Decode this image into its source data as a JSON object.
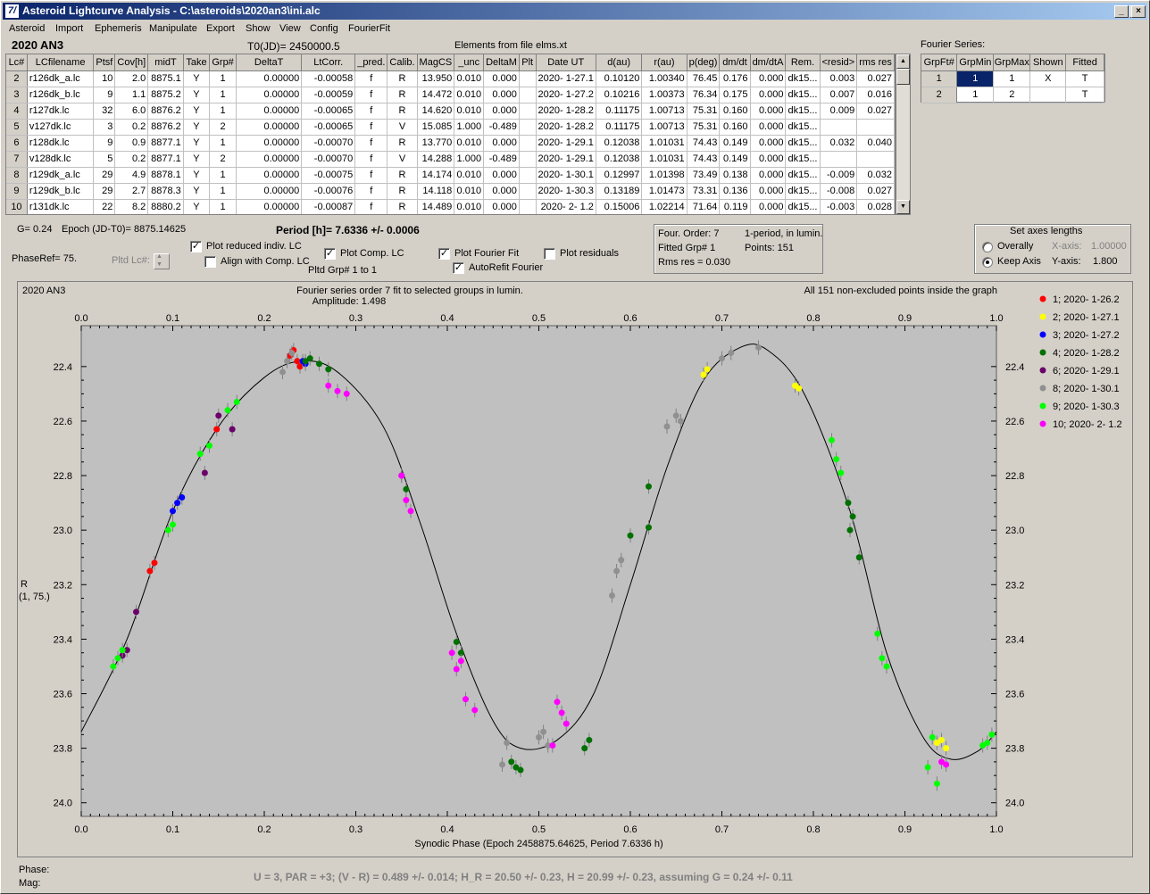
{
  "window": {
    "title": "Asteroid Lightcurve Analysis - C:\\asteroids\\2020an3\\ini.alc",
    "icon": "program-icon"
  },
  "menu": [
    "Asteroid",
    "Import",
    "Ephemeris",
    "Manipulate",
    "Export",
    "Show",
    "View",
    "Config",
    "FourierFit"
  ],
  "header": {
    "asteroid": "2020 AN3",
    "t0": "T0(JD)= 2450000.5",
    "elements": "Elements from file elms.xt"
  },
  "grid": {
    "columns": [
      "Lc#",
      "LCfilename",
      "Ptsf",
      "Cov[h]",
      "midT",
      "Take",
      "Grp#",
      "DeltaT",
      "LtCorr.",
      "_pred.",
      "Calib.",
      "MagCS",
      "_unc",
      "DeltaM",
      "Plt",
      "Date UT",
      "d(au)",
      "r(au)",
      "p(deg)",
      "dm/dt",
      "dm/dtA",
      "Rem.",
      "<resid>",
      "rms res"
    ],
    "rows": [
      [
        "2",
        "r126dk_a.lc",
        "10",
        "2.0",
        "8875.1",
        "Y",
        "1",
        "0.00000",
        "-0.00058",
        "f",
        "R",
        "13.950",
        "0.010",
        "0.000",
        "",
        "2020- 1-27.1",
        "0.10120",
        "1.00340",
        "76.45",
        "0.176",
        "0.000",
        "dk15...",
        "0.003",
        "0.027"
      ],
      [
        "3",
        "r126dk_b.lc",
        "9",
        "1.1",
        "8875.2",
        "Y",
        "1",
        "0.00000",
        "-0.00059",
        "f",
        "R",
        "14.472",
        "0.010",
        "0.000",
        "",
        "2020- 1-27.2",
        "0.10216",
        "1.00373",
        "76.34",
        "0.175",
        "0.000",
        "dk15...",
        "0.007",
        "0.016"
      ],
      [
        "4",
        "r127dk.lc",
        "32",
        "6.0",
        "8876.2",
        "Y",
        "1",
        "0.00000",
        "-0.00065",
        "f",
        "R",
        "14.620",
        "0.010",
        "0.000",
        "",
        "2020- 1-28.2",
        "0.11175",
        "1.00713",
        "75.31",
        "0.160",
        "0.000",
        "dk15...",
        "0.009",
        "0.027"
      ],
      [
        "5",
        "v127dk.lc",
        "3",
        "0.2",
        "8876.2",
        "Y",
        "2",
        "0.00000",
        "-0.00065",
        "f",
        "V",
        "15.085",
        "1.000",
        "-0.489",
        "",
        "2020- 1-28.2",
        "0.11175",
        "1.00713",
        "75.31",
        "0.160",
        "0.000",
        "dk15...",
        "",
        ""
      ],
      [
        "6",
        "r128dk.lc",
        "9",
        "0.9",
        "8877.1",
        "Y",
        "1",
        "0.00000",
        "-0.00070",
        "f",
        "R",
        "13.770",
        "0.010",
        "0.000",
        "",
        "2020- 1-29.1",
        "0.12038",
        "1.01031",
        "74.43",
        "0.149",
        "0.000",
        "dk15...",
        "0.032",
        "0.040"
      ],
      [
        "7",
        "v128dk.lc",
        "5",
        "0.2",
        "8877.1",
        "Y",
        "2",
        "0.00000",
        "-0.00070",
        "f",
        "V",
        "14.288",
        "1.000",
        "-0.489",
        "",
        "2020- 1-29.1",
        "0.12038",
        "1.01031",
        "74.43",
        "0.149",
        "0.000",
        "dk15...",
        "",
        ""
      ],
      [
        "8",
        "r129dk_a.lc",
        "29",
        "4.9",
        "8878.1",
        "Y",
        "1",
        "0.00000",
        "-0.00075",
        "f",
        "R",
        "14.174",
        "0.010",
        "0.000",
        "",
        "2020- 1-30.1",
        "0.12997",
        "1.01398",
        "73.49",
        "0.138",
        "0.000",
        "dk15...",
        "-0.009",
        "0.032"
      ],
      [
        "9",
        "r129dk_b.lc",
        "29",
        "2.7",
        "8878.3",
        "Y",
        "1",
        "0.00000",
        "-0.00076",
        "f",
        "R",
        "14.118",
        "0.010",
        "0.000",
        "",
        "2020- 1-30.3",
        "0.13189",
        "1.01473",
        "73.31",
        "0.136",
        "0.000",
        "dk15...",
        "-0.008",
        "0.027"
      ],
      [
        "10",
        "r131dk.lc",
        "22",
        "8.2",
        "8880.2",
        "Y",
        "1",
        "0.00000",
        "-0.00087",
        "f",
        "R",
        "14.489",
        "0.010",
        "0.000",
        "",
        "2020- 2- 1.2",
        "0.15006",
        "1.02214",
        "71.64",
        "0.119",
        "0.000",
        "dk15...",
        "-0.003",
        "0.028"
      ]
    ]
  },
  "fourier_grid": {
    "title": "Fourier Series:",
    "columns": [
      "GrpFt#",
      "GrpMin",
      "GrpMax",
      "Shown",
      "Fitted"
    ],
    "rows": [
      [
        "1",
        "1",
        "1",
        "X",
        "T"
      ],
      [
        "2",
        "1",
        "2",
        "",
        "T"
      ]
    ]
  },
  "controls": {
    "g": "G= 0.24",
    "epoch": "Epoch (JD-T0)= 8875.14625",
    "period": "Period [h]= 7.6336 +/- 0.0006",
    "phaseref": "PhaseRef= 75.",
    "pltd_lc": "Pltd Lc#:",
    "plot_reduced": "Plot reduced indiv. LC",
    "align": "Align with Comp. LC",
    "plot_comp": "Plot Comp. LC",
    "pltd_grp": "Pltd Grp#  1   to   1",
    "plot_fourier": "Plot Fourier Fit",
    "autorefit": "AutoRefit Fourier",
    "plot_residuals": "Plot residuals",
    "checks": {
      "plot_reduced": true,
      "align": false,
      "plot_comp": true,
      "plot_fourier": true,
      "autorefit": true,
      "plot_residuals": false
    }
  },
  "fitinfo": {
    "order": "Four. Order:  7",
    "period_lumin": "1-period, in lumin.",
    "fitted": "Fitted Grp# 1",
    "points": "Points: 151",
    "rms": "Rms res     = 0.030"
  },
  "axes_box": {
    "title": "Set axes lengths",
    "overally": "Overally",
    "keep": "Keep Axis",
    "xaxis_label": "X-axis:",
    "xaxis_val": "1.00000",
    "yaxis_label": "Y-axis:",
    "yaxis_val": "1.800",
    "selected": "keep"
  },
  "chart_data": {
    "type": "scatter",
    "title_left": "2020 AN3",
    "title": "Fourier series order 7 fit to selected groups in lumin.",
    "subtitle": "Amplitude: 1.498",
    "title_right": "All 151 non-excluded points inside the graph",
    "xlabel": "Synodic Phase (Epoch 2458875.64625, Period 7.6336 h)",
    "ylabel": "R",
    "ylabel2": "(1, 75.)",
    "xlim": [
      0.0,
      1.0
    ],
    "ylim": [
      24.05,
      22.25
    ],
    "xticks": [
      "0.0",
      "0.1",
      "0.2",
      "0.3",
      "0.4",
      "0.5",
      "0.6",
      "0.7",
      "0.8",
      "0.9",
      "1.0"
    ],
    "yticks": [
      "22.4",
      "22.6",
      "22.8",
      "23.0",
      "23.2",
      "23.4",
      "23.6",
      "23.8",
      "24.0"
    ],
    "grid": false,
    "legend_position": "right",
    "curve": [
      [
        0.0,
        23.74
      ],
      [
        0.05,
        23.4
      ],
      [
        0.1,
        22.93
      ],
      [
        0.15,
        22.62
      ],
      [
        0.2,
        22.44
      ],
      [
        0.24,
        22.38
      ],
      [
        0.28,
        22.42
      ],
      [
        0.33,
        22.62
      ],
      [
        0.37,
        22.97
      ],
      [
        0.41,
        23.38
      ],
      [
        0.45,
        23.7
      ],
      [
        0.48,
        23.8
      ],
      [
        0.52,
        23.77
      ],
      [
        0.56,
        23.6
      ],
      [
        0.6,
        23.2
      ],
      [
        0.64,
        22.77
      ],
      [
        0.68,
        22.45
      ],
      [
        0.72,
        22.33
      ],
      [
        0.75,
        22.34
      ],
      [
        0.79,
        22.5
      ],
      [
        0.84,
        22.93
      ],
      [
        0.88,
        23.45
      ],
      [
        0.92,
        23.76
      ],
      [
        0.95,
        23.84
      ],
      [
        0.98,
        23.81
      ],
      [
        1.0,
        23.74
      ]
    ],
    "series": [
      {
        "name": "1; 2020- 1-26.2",
        "color": "#ff0000",
        "points": [
          [
            0.075,
            23.15
          ],
          [
            0.08,
            23.12
          ],
          [
            0.148,
            22.63
          ],
          [
            0.228,
            22.36
          ],
          [
            0.232,
            22.34
          ],
          [
            0.236,
            22.38
          ],
          [
            0.239,
            22.4
          ]
        ]
      },
      {
        "name": "2; 2020- 1-27.1",
        "color": "#ffff00",
        "points": [
          [
            0.68,
            22.43
          ],
          [
            0.684,
            22.41
          ],
          [
            0.78,
            22.47
          ],
          [
            0.784,
            22.48
          ],
          [
            0.935,
            23.78
          ],
          [
            0.94,
            23.77
          ],
          [
            0.945,
            23.8
          ]
        ]
      },
      {
        "name": "3; 2020- 1-27.2",
        "color": "#0000ff",
        "points": [
          [
            0.1,
            22.93
          ],
          [
            0.105,
            22.9
          ],
          [
            0.11,
            22.88
          ],
          [
            0.242,
            22.38
          ],
          [
            0.245,
            22.39
          ]
        ]
      },
      {
        "name": "4; 2020- 1-28.2",
        "color": "#007000",
        "points": [
          [
            0.245,
            22.38
          ],
          [
            0.25,
            22.37
          ],
          [
            0.26,
            22.39
          ],
          [
            0.27,
            22.41
          ],
          [
            0.35,
            22.8
          ],
          [
            0.355,
            22.85
          ],
          [
            0.41,
            23.41
          ],
          [
            0.415,
            23.45
          ],
          [
            0.47,
            23.85
          ],
          [
            0.475,
            23.87
          ],
          [
            0.48,
            23.88
          ],
          [
            0.55,
            23.8
          ],
          [
            0.555,
            23.77
          ],
          [
            0.62,
            22.84
          ],
          [
            0.6,
            23.02
          ],
          [
            0.62,
            22.99
          ],
          [
            0.84,
            23.0
          ],
          [
            0.85,
            23.1
          ],
          [
            0.843,
            22.95
          ],
          [
            0.838,
            22.9
          ]
        ]
      },
      {
        "name": "6; 2020- 1-29.1",
        "color": "#6a006a",
        "points": [
          [
            0.045,
            23.46
          ],
          [
            0.05,
            23.44
          ],
          [
            0.06,
            23.3
          ],
          [
            0.135,
            22.79
          ],
          [
            0.165,
            22.63
          ],
          [
            0.15,
            22.58
          ]
        ]
      },
      {
        "name": "8; 2020- 1-30.1",
        "color": "#909090",
        "points": [
          [
            0.22,
            22.42
          ],
          [
            0.225,
            22.38
          ],
          [
            0.23,
            22.35
          ],
          [
            0.46,
            23.86
          ],
          [
            0.465,
            23.78
          ],
          [
            0.5,
            23.76
          ],
          [
            0.505,
            23.74
          ],
          [
            0.51,
            23.79
          ],
          [
            0.58,
            23.24
          ],
          [
            0.585,
            23.15
          ],
          [
            0.59,
            23.11
          ],
          [
            0.64,
            22.62
          ],
          [
            0.65,
            22.58
          ],
          [
            0.7,
            22.37
          ],
          [
            0.71,
            22.35
          ],
          [
            0.74,
            22.33
          ],
          [
            0.655,
            22.6
          ]
        ]
      },
      {
        "name": "9; 2020- 1-30.3",
        "color": "#00ff00",
        "points": [
          [
            0.035,
            23.5
          ],
          [
            0.04,
            23.47
          ],
          [
            0.045,
            23.44
          ],
          [
            0.095,
            23.0
          ],
          [
            0.1,
            22.98
          ],
          [
            0.13,
            22.72
          ],
          [
            0.14,
            22.69
          ],
          [
            0.17,
            22.53
          ],
          [
            0.16,
            22.56
          ],
          [
            0.82,
            22.67
          ],
          [
            0.825,
            22.74
          ],
          [
            0.83,
            22.79
          ],
          [
            0.87,
            23.38
          ],
          [
            0.875,
            23.47
          ],
          [
            0.88,
            23.5
          ],
          [
            0.925,
            23.87
          ],
          [
            0.93,
            23.76
          ],
          [
            0.935,
            23.93
          ],
          [
            0.985,
            23.79
          ],
          [
            0.99,
            23.78
          ],
          [
            0.995,
            23.75
          ]
        ]
      },
      {
        "name": "10; 2020- 2- 1.2",
        "color": "#ff00ff",
        "points": [
          [
            0.27,
            22.47
          ],
          [
            0.28,
            22.49
          ],
          [
            0.29,
            22.5
          ],
          [
            0.35,
            22.8
          ],
          [
            0.36,
            22.93
          ],
          [
            0.355,
            22.89
          ],
          [
            0.405,
            23.45
          ],
          [
            0.41,
            23.51
          ],
          [
            0.415,
            23.48
          ],
          [
            0.42,
            23.62
          ],
          [
            0.43,
            23.66
          ],
          [
            0.52,
            23.63
          ],
          [
            0.525,
            23.67
          ],
          [
            0.53,
            23.71
          ],
          [
            0.515,
            23.79
          ],
          [
            0.94,
            23.85
          ],
          [
            0.945,
            23.86
          ]
        ]
      }
    ]
  },
  "status": {
    "phase_label": "Phase:",
    "mag_label": "Mag:",
    "summary": "U = 3, PAR = +3; (V - R) = 0.489 +/- 0.014; H_R = 20.50 +/- 0.23, H = 20.99 +/- 0.23, assuming G = 0.24 +/- 0.11"
  }
}
